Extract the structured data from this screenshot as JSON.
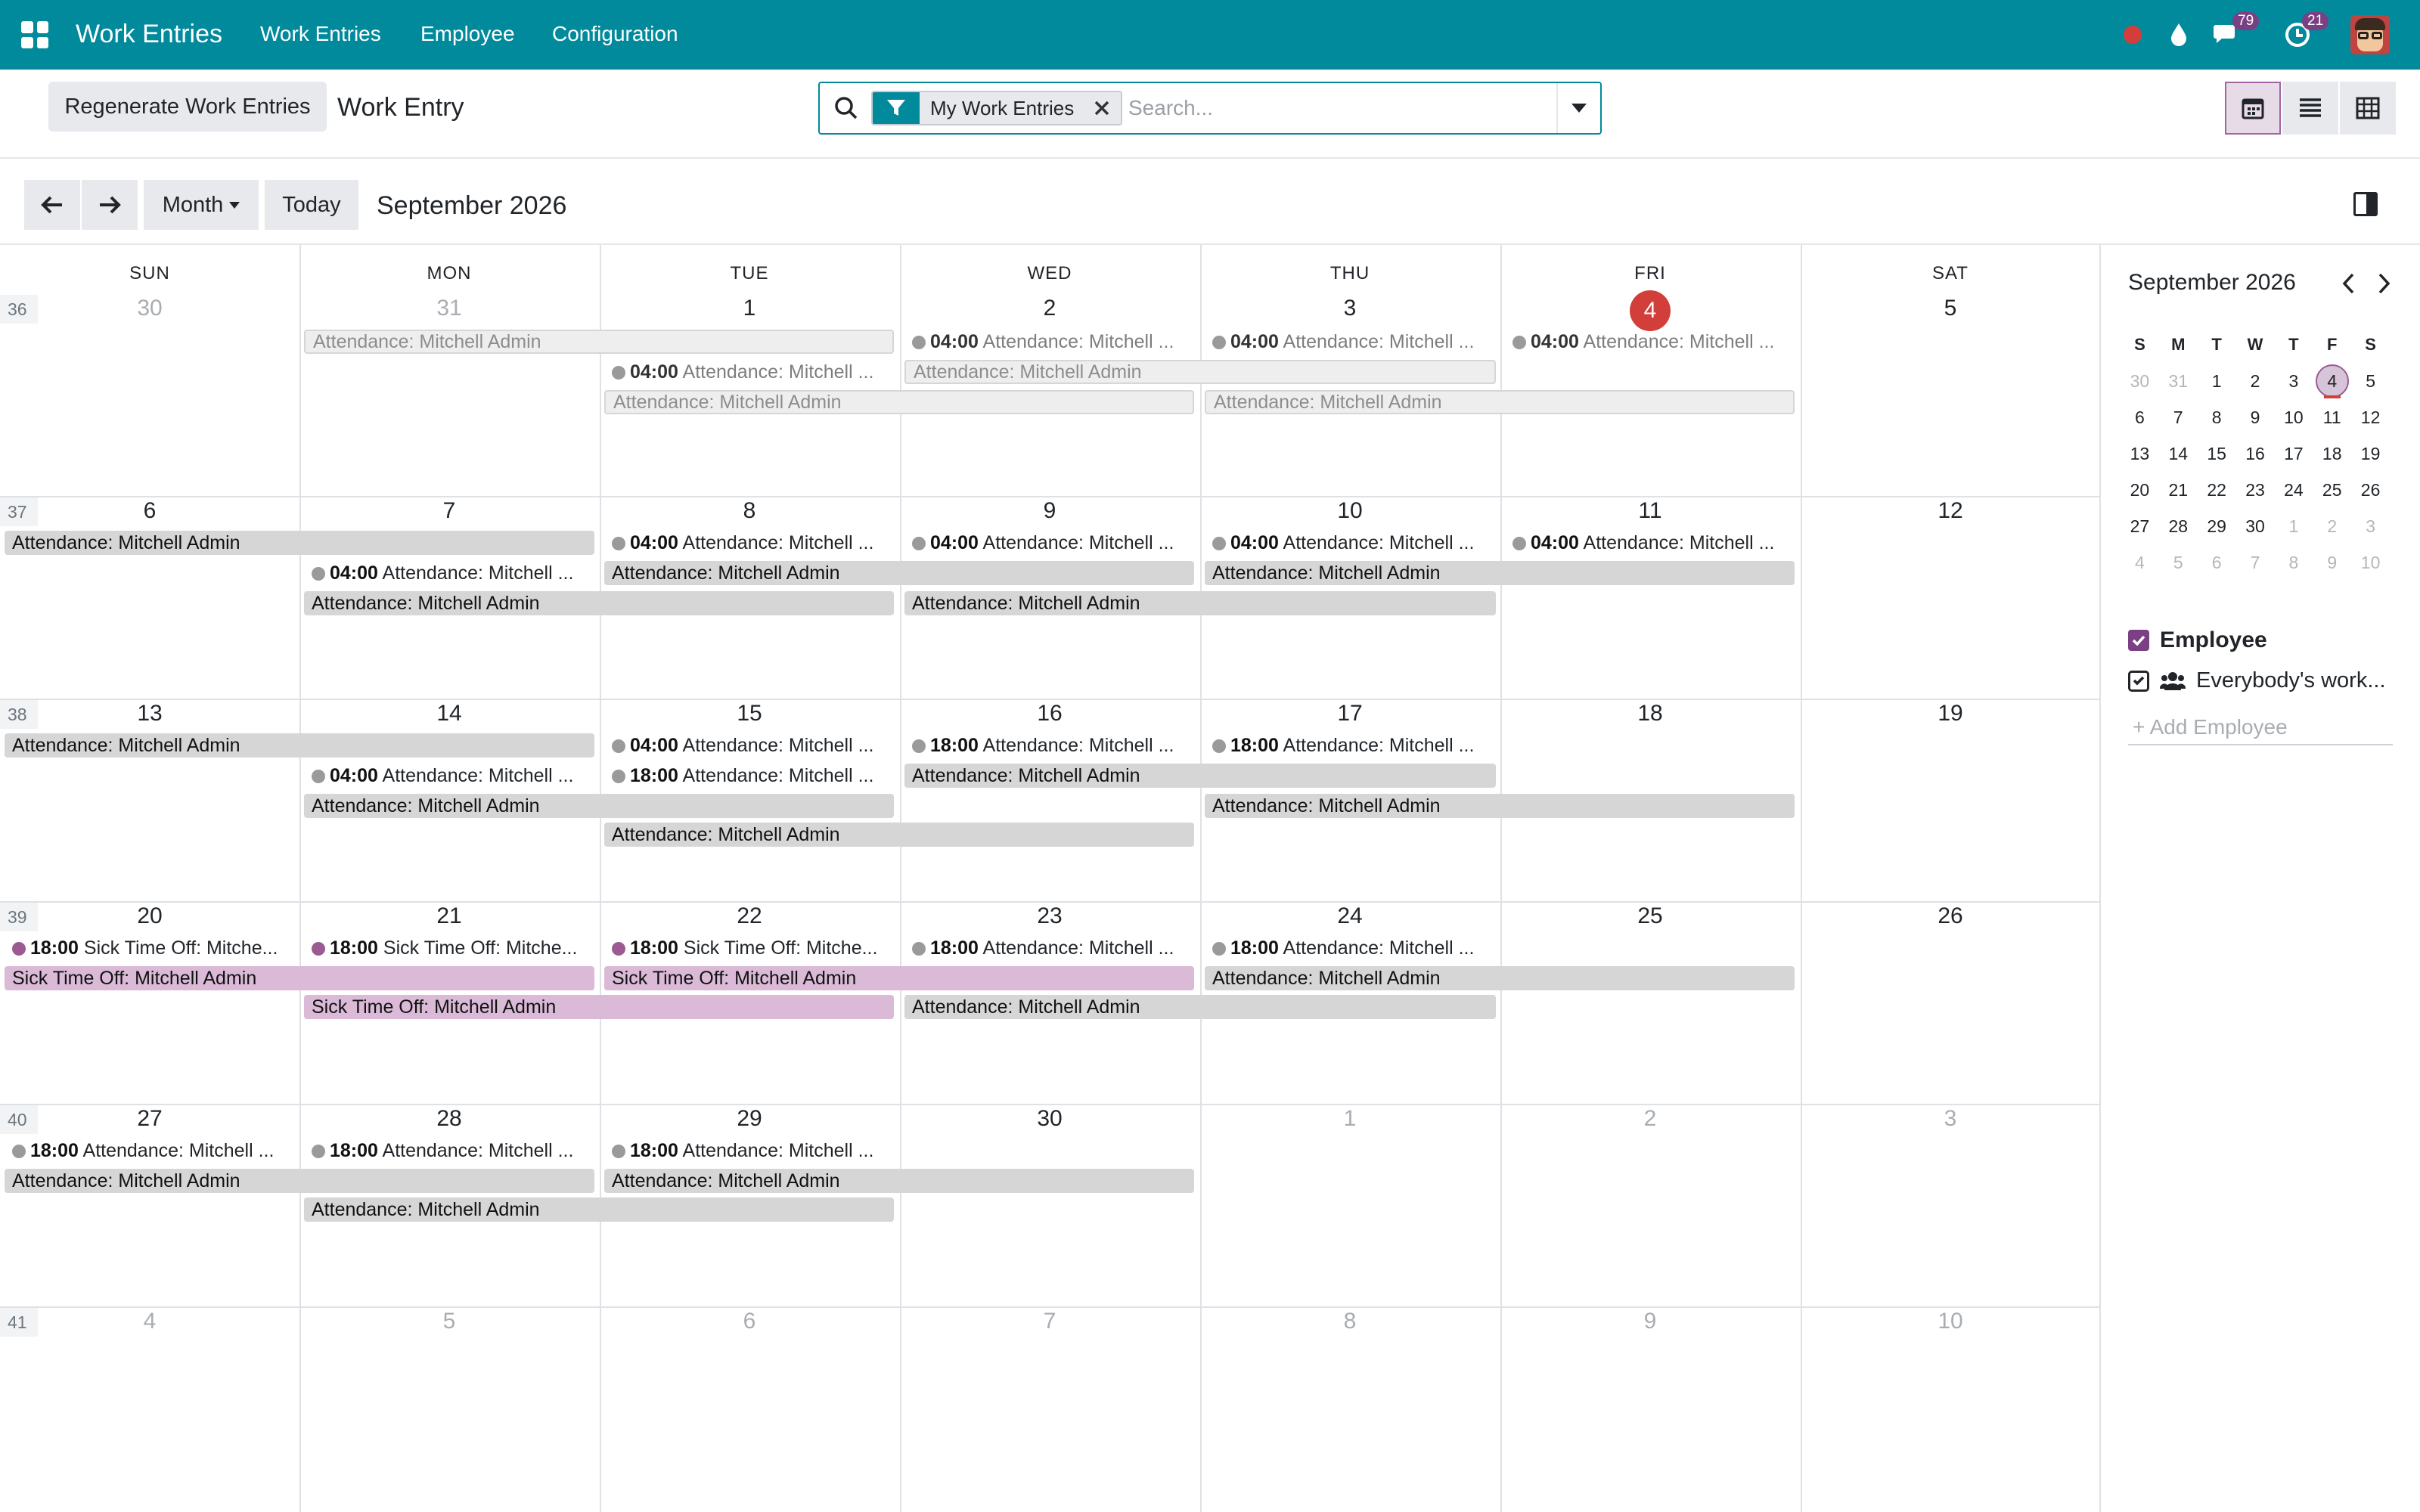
{
  "app": {
    "title": "Work Entries"
  },
  "menu": [
    {
      "label": "Work Entries"
    },
    {
      "label": "Employee"
    },
    {
      "label": "Configuration"
    }
  ],
  "systray": {
    "chat_count": "79",
    "activity_count": "21"
  },
  "control": {
    "regenerate_label": "Regenerate Work Entries",
    "breadcrumb": "Work Entry",
    "search": {
      "facet_label": "My Work Entries",
      "placeholder": "Search..."
    }
  },
  "calendar": {
    "scale_label": "Month",
    "today_label": "Today",
    "period": "September 2026",
    "weekdays": [
      "SUN",
      "MON",
      "TUE",
      "WED",
      "THU",
      "FRI",
      "SAT"
    ],
    "weeks": [
      {
        "num": "36",
        "days": [
          "30",
          "31",
          "1",
          "2",
          "3",
          "4",
          "5"
        ]
      },
      {
        "num": "37",
        "days": [
          "6",
          "7",
          "8",
          "9",
          "10",
          "11",
          "12"
        ]
      },
      {
        "num": "38",
        "days": [
          "13",
          "14",
          "15",
          "16",
          "17",
          "18",
          "19"
        ]
      },
      {
        "num": "39",
        "days": [
          "20",
          "21",
          "22",
          "23",
          "24",
          "25",
          "26"
        ]
      },
      {
        "num": "40",
        "days": [
          "27",
          "28",
          "29",
          "30",
          "1",
          "2",
          "3"
        ]
      },
      {
        "num": "41",
        "days": [
          "4",
          "5",
          "6",
          "7",
          "8",
          "9",
          "10"
        ]
      }
    ],
    "events": {
      "attendance": "Attendance: Mitchell Admin",
      "attendance_short": "Attendance: Mitchell ...",
      "sick": "Sick Time Off: Mitchell Admin",
      "sick_short": "Sick Time Off: Mitche...",
      "t0400": "04:00",
      "t1800": "18:00"
    }
  },
  "sidebar": {
    "month_title": "September 2026",
    "mini_headers": [
      "S",
      "M",
      "T",
      "W",
      "T",
      "F",
      "S"
    ],
    "mini_weeks": [
      [
        "30",
        "31",
        "1",
        "2",
        "3",
        "4",
        "5"
      ],
      [
        "6",
        "7",
        "8",
        "9",
        "10",
        "11",
        "12"
      ],
      [
        "13",
        "14",
        "15",
        "16",
        "17",
        "18",
        "19"
      ],
      [
        "20",
        "21",
        "22",
        "23",
        "24",
        "25",
        "26"
      ],
      [
        "27",
        "28",
        "29",
        "30",
        "1",
        "2",
        "3"
      ],
      [
        "4",
        "5",
        "6",
        "7",
        "8",
        "9",
        "10"
      ]
    ],
    "filter_title": "Employee",
    "filter_item": "Everybody's work...",
    "add_employee": "+ Add Employee"
  },
  "colors": {
    "topbar": "#018a9c",
    "accent": "#7b3f83",
    "today": "#d23f3a",
    "attendance": "#d6d6d6",
    "sick": "#dbbad7"
  }
}
